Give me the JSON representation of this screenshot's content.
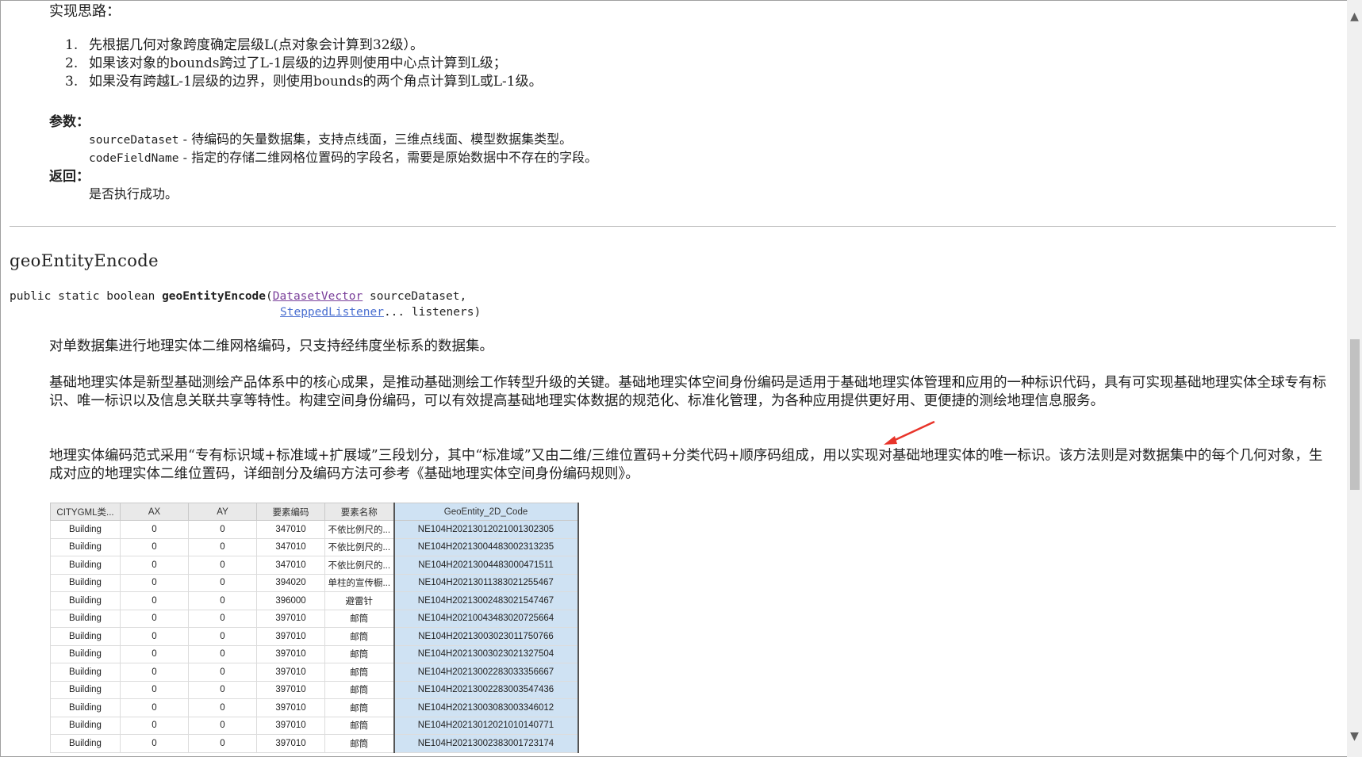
{
  "intro_heading": "实现思路：",
  "steps": [
    {
      "num": "1.",
      "text": "先根据几何对象跨度确定层级L(点对象会计算到32级）。"
    },
    {
      "num": "2.",
      "text": "如果该对象的bounds跨过了L-1层级的边界则使用中心点计算到L级；"
    },
    {
      "num": "3.",
      "text": "如果没有跨越L-1层级的边界，则使用bounds的两个角点计算到L或L-1级。"
    }
  ],
  "params_label": "参数：",
  "params": [
    {
      "name": "sourceDataset",
      "desc": " - 待编码的矢量数据集，支持点线面，三维点线面、模型数据集类型。"
    },
    {
      "name": "codeFieldName",
      "desc": " - 指定的存储二维网格位置码的字段名，需要是原始数据中不存在的字段。"
    }
  ],
  "returns_label": "返回：",
  "returns_text": "是否执行成功。",
  "method": {
    "title": "geoEntityEncode",
    "sig_prefix": "public static boolean ",
    "sig_name": "geoEntityEncode",
    "sig_open": "(",
    "param1_type": "DatasetVector",
    "param1_name": " sourceDataset,",
    "param2_type": "SteppedListener",
    "param2_name": "... listeners)"
  },
  "paragraphs": [
    "对单数据集进行地理实体二维网格编码，只支持经纬度坐标系的数据集。",
    "基础地理实体是新型基础测绘产品体系中的核心成果，是推动基础测绘工作转型升级的关键。基础地理实体空间身份编码是适用于基础地理实体管理和应用的一种标识代码，具有可实现基础地理实体全球专有标识、唯一标识以及信息关联共享等特性。构建空间身份编码，可以有效提高基础地理实体数据的规范化、标准化管理，为各种应用提供更好用、更便捷的测绘地理信息服务。",
    "地理实体编码范式采用“专有标识域+标准域+扩展域”三段划分，其中“标准域”又由二维/三维位置码+分类代码+顺序码组成，用以实现对基础地理实体的唯一标识。该方法则是对数据集中的每个几何对象，生成对应的地理实体二维位置码，详细剖分及编码方法可参考《基础地理实体空间身份编码规则》。"
  ],
  "table": {
    "columns": [
      "CITYGML类...",
      "AX",
      "AY",
      "要素编码",
      "要素名称",
      "GeoEntity_2D_Code"
    ],
    "rows": [
      [
        "Building",
        "0",
        "0",
        "347010",
        "不依比例尺的...",
        "NE104H20213012021001302305"
      ],
      [
        "Building",
        "0",
        "0",
        "347010",
        "不依比例尺的...",
        "NE104H20213004483002313235"
      ],
      [
        "Building",
        "0",
        "0",
        "347010",
        "不依比例尺的...",
        "NE104H20213004483000471511"
      ],
      [
        "Building",
        "0",
        "0",
        "394020",
        "单柱的宣传橱...",
        "NE104H20213011383021255467"
      ],
      [
        "Building",
        "0",
        "0",
        "396000",
        "避雷针",
        "NE104H20213002483021547467"
      ],
      [
        "Building",
        "0",
        "0",
        "397010",
        "邮筒",
        "NE104H20210043483020725664"
      ],
      [
        "Building",
        "0",
        "0",
        "397010",
        "邮筒",
        "NE104H20213003023011750766"
      ],
      [
        "Building",
        "0",
        "0",
        "397010",
        "邮筒",
        "NE104H20213003023021327504"
      ],
      [
        "Building",
        "0",
        "0",
        "397010",
        "邮筒",
        "NE104H20213002283033356667"
      ],
      [
        "Building",
        "0",
        "0",
        "397010",
        "邮筒",
        "NE104H20213002283003547436"
      ],
      [
        "Building",
        "0",
        "0",
        "397010",
        "邮筒",
        "NE104H20213003083003346012"
      ],
      [
        "Building",
        "0",
        "0",
        "397010",
        "邮筒",
        "NE104H20213012021010140771"
      ],
      [
        "Building",
        "0",
        "0",
        "397010",
        "邮筒",
        "NE104H20213002383001723174"
      ]
    ]
  },
  "colors": {
    "visited_link": "#7a3f9a",
    "link": "#4a6fd0",
    "highlight_column": "#cfe2f3",
    "arrow": "#e8342a"
  },
  "icons": {
    "scroll_up": "chevron-up-icon",
    "scroll_down": "chevron-down-icon",
    "annotation": "red-arrow-icon"
  }
}
